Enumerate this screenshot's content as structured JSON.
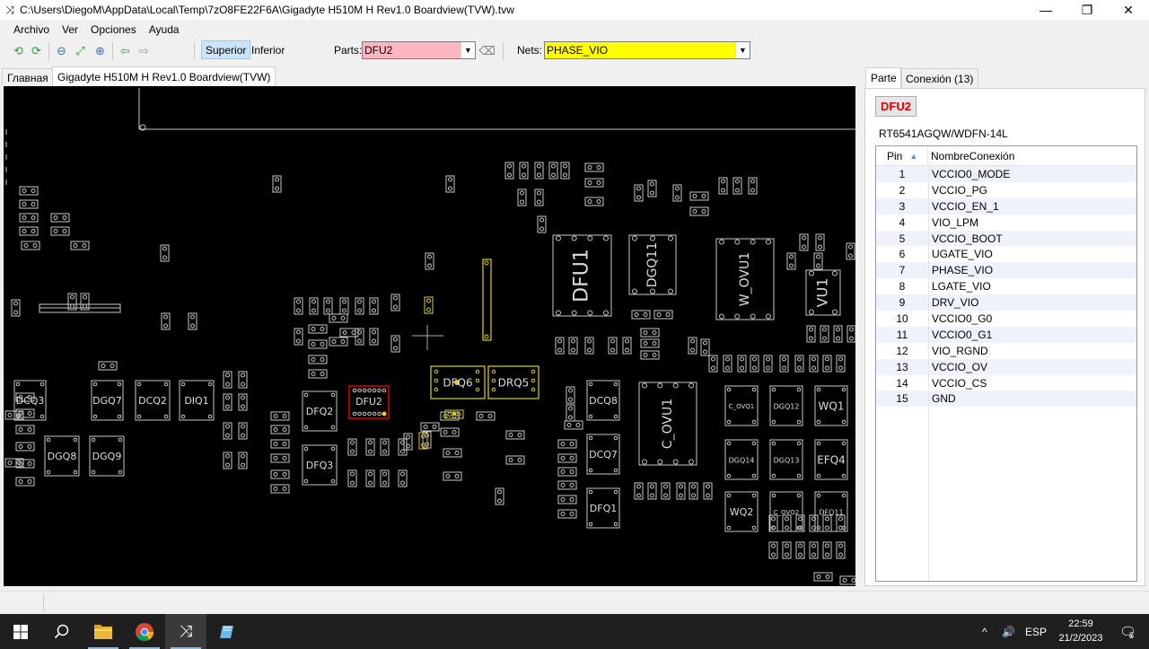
{
  "window": {
    "title": "C:\\Users\\DiegoM\\AppData\\Local\\Temp\\7zO8FE22F6A\\Gigadyte H510M H Rev1.0 Boardview(TVW).tvw",
    "app_icon": "shuffle-icon",
    "controls": {
      "minimize": "—",
      "maximize": "❐",
      "close": "✕"
    }
  },
  "menu": [
    "Archivo",
    "Ver",
    "Opciones",
    "Ayuda"
  ],
  "toolbar": {
    "icons": [
      "rotate-left-icon",
      "rotate-right-icon",
      "zoom-out-icon",
      "fit-screen-icon",
      "zoom-in-icon",
      "arrow-left-icon",
      "arrow-right-icon"
    ],
    "side_top": "Superior",
    "side_bottom": "Inferior",
    "parts_label": "Parts:",
    "parts_value": "DFU2",
    "nets_label": "Nets:",
    "nets_value": "PHASE_VIO",
    "parts_bg": "#ffb6c1",
    "nets_bg": "#ffff00"
  },
  "tabs": [
    "Главная",
    "Gigadyte H510M H Rev1.0 Boardview(TVW)"
  ],
  "board": {
    "labels": [
      "DFU1",
      "DGQ11",
      "W_OVU1",
      "VU1",
      "DFQ6",
      "DRQ5",
      "DFU2",
      "DCQ3",
      "DGQ7",
      "DCQ2",
      "DIQ1",
      "DGQ8",
      "DGQ9",
      "DFQ2",
      "DFQ3",
      "DCQ8",
      "DCQ7",
      "DFQ1",
      "C_OVU1",
      "C_OVQ1",
      "DGQ12",
      "WQ1",
      "DGQ14",
      "DGQ13",
      "EFQ4",
      "WQ2",
      "C_OVQ2",
      "DFQ11"
    ],
    "highlight_color": "#e0d020",
    "selected_color": "#e00000"
  },
  "panel": {
    "tabs": [
      "Parte",
      "Conexión (13)"
    ],
    "part_name": "DFU2",
    "part_type": "RT6541AGQW/WDFN-14L",
    "columns": [
      "Pin",
      "NombreConexión"
    ],
    "pins": [
      {
        "pin": "1",
        "net": "VCCIO0_MODE"
      },
      {
        "pin": "2",
        "net": "VCCIO_PG"
      },
      {
        "pin": "3",
        "net": "VCCIO_EN_1"
      },
      {
        "pin": "4",
        "net": "VIO_LPM"
      },
      {
        "pin": "5",
        "net": "VCCIO_BOOT"
      },
      {
        "pin": "6",
        "net": "UGATE_VIO"
      },
      {
        "pin": "7",
        "net": "PHASE_VIO"
      },
      {
        "pin": "8",
        "net": "LGATE_VIO"
      },
      {
        "pin": "9",
        "net": "DRV_VIO"
      },
      {
        "pin": "10",
        "net": "VCCIO0_G0"
      },
      {
        "pin": "11",
        "net": "VCCIO0_G1"
      },
      {
        "pin": "12",
        "net": "VIO_RGND"
      },
      {
        "pin": "13",
        "net": "VCCIO_OV"
      },
      {
        "pin": "14",
        "net": "VCCIO_CS"
      },
      {
        "pin": "15",
        "net": "GND"
      }
    ]
  },
  "taskbar": {
    "apps": [
      "windows-start-icon",
      "search-icon",
      "file-explorer-icon",
      "chrome-icon",
      "boardviewer-icon",
      "notepad-icon"
    ],
    "tray_chevron": "^",
    "volume_icon": "🔊",
    "language": "ESP",
    "time": "22:59",
    "date": "21/2/2023",
    "notifications": "5"
  }
}
